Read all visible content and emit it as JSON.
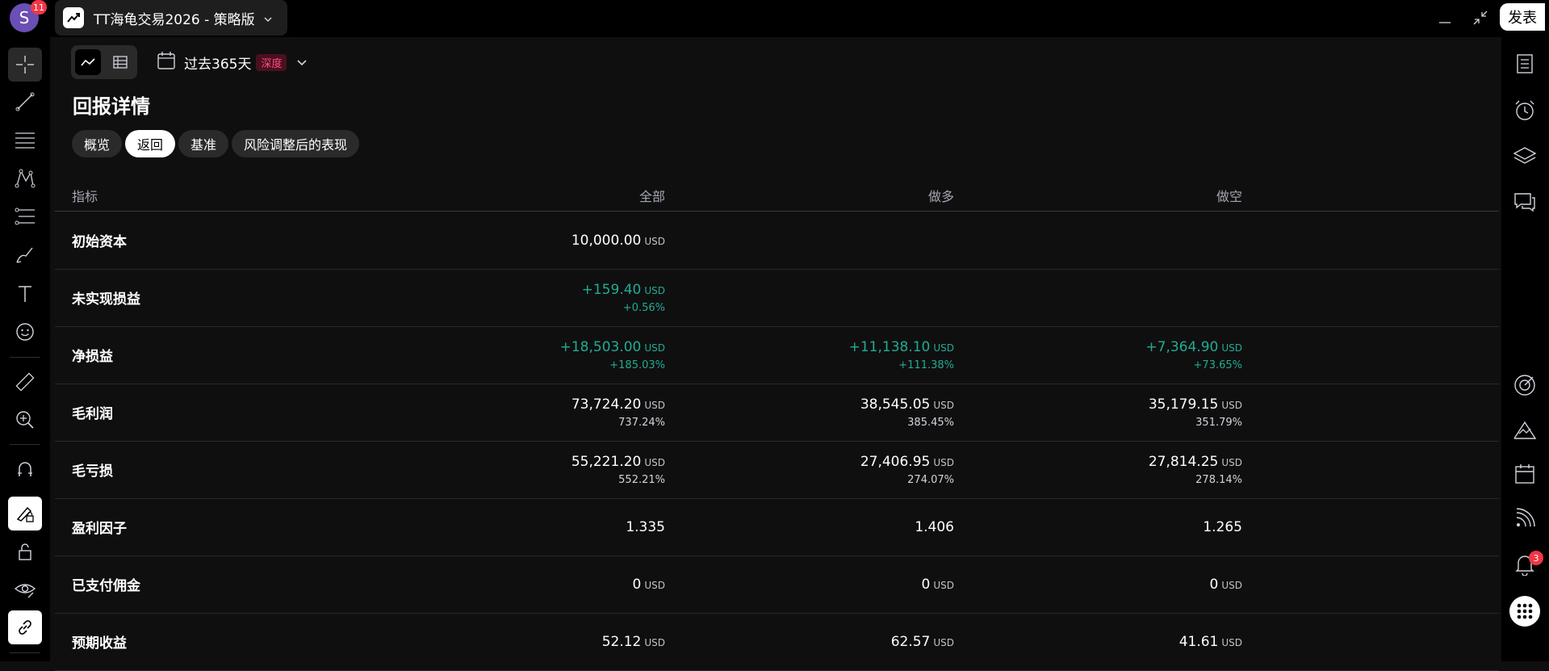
{
  "app": {
    "avatar_letter": "S",
    "avatar_badge": "11",
    "tab_title": "TT海龟交易2026 - 策略版",
    "publish_label": "发表"
  },
  "toolbar": {
    "date_range": "过去365天",
    "deep_badge": "深度"
  },
  "section_title": "回报详情",
  "subtabs": [
    "概览",
    "返回",
    "基准",
    "风险调整后的表现"
  ],
  "active_subtab": "返回",
  "table": {
    "headers": [
      "指标",
      "全部",
      "做多",
      "做空"
    ],
    "rows": [
      {
        "label": "初始资本",
        "all": {
          "value": "10,000.00",
          "unit": "USD"
        }
      },
      {
        "label": "未实现损益",
        "all": {
          "value": "+159.40",
          "unit": "USD",
          "pct": "+0.56%"
        }
      },
      {
        "label": "净损益",
        "all": {
          "value": "+18,503.00",
          "unit": "USD",
          "pct": "+185.03%"
        },
        "long": {
          "value": "+11,138.10",
          "unit": "USD",
          "pct": "+111.38%"
        },
        "short": {
          "value": "+7,364.90",
          "unit": "USD",
          "pct": "+73.65%"
        }
      },
      {
        "label": "毛利润",
        "all": {
          "value": "73,724.20",
          "unit": "USD",
          "pct": "737.24%"
        },
        "long": {
          "value": "38,545.05",
          "unit": "USD",
          "pct": "385.45%"
        },
        "short": {
          "value": "35,179.15",
          "unit": "USD",
          "pct": "351.79%"
        }
      },
      {
        "label": "毛亏损",
        "all": {
          "value": "55,221.20",
          "unit": "USD",
          "pct": "552.21%"
        },
        "long": {
          "value": "27,406.95",
          "unit": "USD",
          "pct": "274.07%"
        },
        "short": {
          "value": "27,814.25",
          "unit": "USD",
          "pct": "278.14%"
        }
      },
      {
        "label": "盈利因子",
        "all": {
          "value": "1.335"
        },
        "long": {
          "value": "1.406"
        },
        "short": {
          "value": "1.265"
        }
      },
      {
        "label": "已支付佣金",
        "all": {
          "value": "0",
          "unit": "USD"
        },
        "long": {
          "value": "0",
          "unit": "USD"
        },
        "short": {
          "value": "0",
          "unit": "USD"
        }
      },
      {
        "label": "预期收益",
        "all": {
          "value": "52.12",
          "unit": "USD"
        },
        "long": {
          "value": "62.57",
          "unit": "USD"
        },
        "short": {
          "value": "41.61",
          "unit": "USD"
        }
      }
    ]
  },
  "right_sidebar": {
    "notification_badge": "3"
  },
  "colors": {
    "positive": "#22ab94",
    "badge_red": "#f23645",
    "accent_pink": "#ff4d7d"
  }
}
